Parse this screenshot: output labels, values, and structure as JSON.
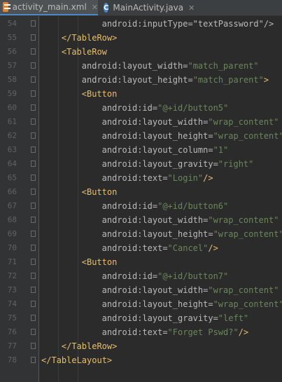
{
  "tabs": [
    {
      "label": "activity_main.xml",
      "icon": "xml-file-icon",
      "active": true
    },
    {
      "label": "MainActivity.java",
      "icon": "java-class-icon",
      "active": false
    }
  ],
  "editor": {
    "lines": [
      {
        "num": "54",
        "indent": 6,
        "parts": [
          {
            "t": "android:inputType=\"textPassword\"/>",
            "c": "attr"
          }
        ]
      },
      {
        "num": "55",
        "indent": 2,
        "parts": [
          {
            "t": "</TableRow>",
            "c": "tag"
          }
        ]
      },
      {
        "num": "56",
        "indent": 2,
        "parts": [
          {
            "t": "<TableRow",
            "c": "tag"
          }
        ]
      },
      {
        "num": "57",
        "indent": 4,
        "parts": [
          {
            "t": "android:layout_width=",
            "c": "attr"
          },
          {
            "t": "\"match_parent\"",
            "c": "val"
          }
        ]
      },
      {
        "num": "58",
        "indent": 4,
        "parts": [
          {
            "t": "android:layout_height=",
            "c": "attr"
          },
          {
            "t": "\"match_parent\"",
            "c": "val"
          },
          {
            "t": ">",
            "c": "tag"
          }
        ]
      },
      {
        "num": "59",
        "indent": 4,
        "parts": [
          {
            "t": "<Button",
            "c": "tag"
          }
        ]
      },
      {
        "num": "60",
        "indent": 6,
        "parts": [
          {
            "t": "android:id=",
            "c": "attr"
          },
          {
            "t": "\"@+id/button5\"",
            "c": "val"
          }
        ]
      },
      {
        "num": "61",
        "indent": 6,
        "parts": [
          {
            "t": "android:layout_width=",
            "c": "attr"
          },
          {
            "t": "\"wrap_content\"",
            "c": "val"
          }
        ]
      },
      {
        "num": "62",
        "indent": 6,
        "parts": [
          {
            "t": "android:layout_height=",
            "c": "attr"
          },
          {
            "t": "\"wrap_content\"",
            "c": "val"
          }
        ]
      },
      {
        "num": "63",
        "indent": 6,
        "parts": [
          {
            "t": "android:layout_column=",
            "c": "attr"
          },
          {
            "t": "\"1\"",
            "c": "val"
          }
        ]
      },
      {
        "num": "64",
        "indent": 6,
        "parts": [
          {
            "t": "android:layout_gravity=",
            "c": "attr"
          },
          {
            "t": "\"right\"",
            "c": "val"
          }
        ]
      },
      {
        "num": "65",
        "indent": 6,
        "parts": [
          {
            "t": "android:text=",
            "c": "attr"
          },
          {
            "t": "\"Login\"",
            "c": "val"
          },
          {
            "t": "/>",
            "c": "tag"
          }
        ]
      },
      {
        "num": "66",
        "indent": 4,
        "parts": [
          {
            "t": "<Button",
            "c": "tag"
          }
        ]
      },
      {
        "num": "67",
        "indent": 6,
        "parts": [
          {
            "t": "android:id=",
            "c": "attr"
          },
          {
            "t": "\"@+id/button6\"",
            "c": "val"
          }
        ]
      },
      {
        "num": "68",
        "indent": 6,
        "parts": [
          {
            "t": "android:layout_width=",
            "c": "attr"
          },
          {
            "t": "\"wrap_content\"",
            "c": "val"
          }
        ]
      },
      {
        "num": "69",
        "indent": 6,
        "parts": [
          {
            "t": "android:layout_height=",
            "c": "attr"
          },
          {
            "t": "\"wrap_content\"",
            "c": "val"
          }
        ]
      },
      {
        "num": "70",
        "indent": 6,
        "parts": [
          {
            "t": "android:text=",
            "c": "attr"
          },
          {
            "t": "\"Cancel\"",
            "c": "val"
          },
          {
            "t": "/>",
            "c": "tag"
          }
        ]
      },
      {
        "num": "71",
        "indent": 4,
        "parts": [
          {
            "t": "<Button",
            "c": "tag"
          }
        ]
      },
      {
        "num": "72",
        "indent": 6,
        "parts": [
          {
            "t": "android:id=",
            "c": "attr"
          },
          {
            "t": "\"@+id/button7\"",
            "c": "val"
          }
        ]
      },
      {
        "num": "73",
        "indent": 6,
        "parts": [
          {
            "t": "android:layout_width=",
            "c": "attr"
          },
          {
            "t": "\"wrap_content\"",
            "c": "val"
          }
        ]
      },
      {
        "num": "74",
        "indent": 6,
        "parts": [
          {
            "t": "android:layout_height=",
            "c": "attr"
          },
          {
            "t": "\"wrap_content\"",
            "c": "val"
          }
        ]
      },
      {
        "num": "75",
        "indent": 6,
        "parts": [
          {
            "t": "android:layout_gravity=",
            "c": "attr"
          },
          {
            "t": "\"left\"",
            "c": "val"
          }
        ]
      },
      {
        "num": "76",
        "indent": 6,
        "parts": [
          {
            "t": "android:text=",
            "c": "attr"
          },
          {
            "t": "\"Forget Pswd?\"",
            "c": "val"
          },
          {
            "t": "/>",
            "c": "tag"
          }
        ]
      },
      {
        "num": "77",
        "indent": 2,
        "parts": [
          {
            "t": "</TableRow>",
            "c": "tag"
          }
        ]
      },
      {
        "num": "78",
        "indent": 0,
        "parts": [
          {
            "t": "</TableLayout>",
            "c": "tag"
          }
        ]
      }
    ]
  }
}
